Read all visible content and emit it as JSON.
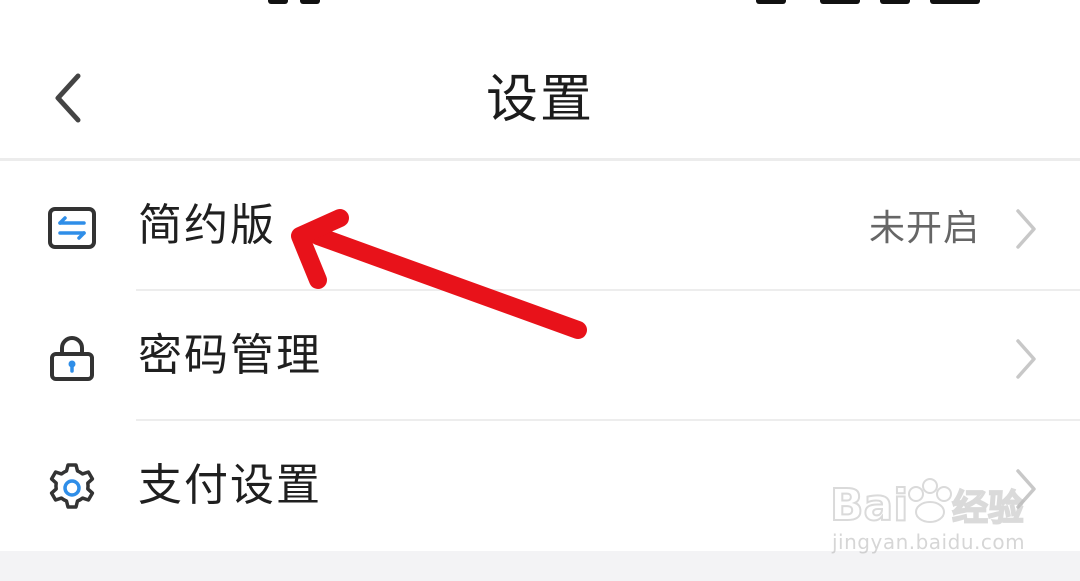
{
  "header": {
    "title": "设置"
  },
  "settings": {
    "items": [
      {
        "label": "简约版",
        "value": "未开启"
      },
      {
        "label": "密码管理",
        "value": ""
      },
      {
        "label": "支付设置",
        "value": ""
      }
    ]
  },
  "icons": {
    "back": "chevron-left-icon",
    "simple_mode": "swap-icon",
    "password": "lock-icon",
    "payment": "gear-icon",
    "row_arrow": "chevron-right-icon"
  },
  "watermark": {
    "logo_text": "Bai du 经验",
    "url": "jingyan.baidu.com"
  },
  "colors": {
    "accent_blue": "#2f8ee8",
    "annotation_red": "#e8121a",
    "text_primary": "#1f1f1f",
    "text_secondary": "#666666",
    "chevron": "#c8c8c8"
  }
}
